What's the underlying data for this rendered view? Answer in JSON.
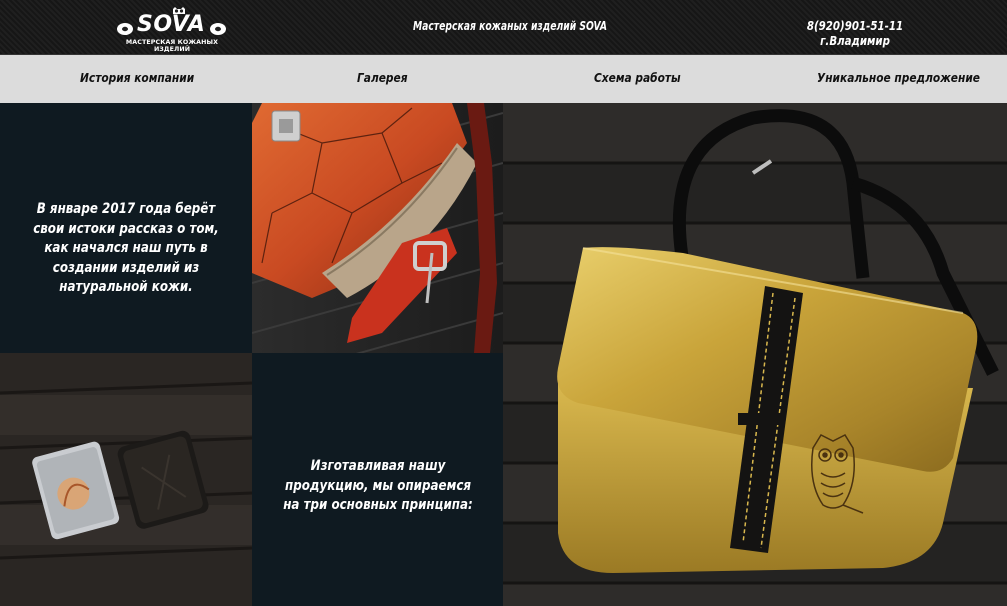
{
  "header": {
    "logo_word": "SOVA",
    "logo_subtitle": "МАСТЕРСКАЯ КОЖАНЫХ ИЗДЕЛИЙ",
    "title": "Мастерская кожаных изделий SOVA",
    "phone_city": "8(920)901-51-11 г.Владимир"
  },
  "nav": {
    "items": [
      {
        "label": "История компании"
      },
      {
        "label": "Галерея"
      },
      {
        "label": "Схема работы"
      },
      {
        "label": "Уникальное предложение"
      }
    ]
  },
  "tiles": {
    "intro_text": "В январе 2017 года берёт свои истоки рассказ о том, как начался наш путь в создании изделий из натуральной кожи.",
    "principles_text": "Изготавливая нашу продукцию, мы опираемся на три основных принципа:"
  },
  "colors": {
    "dark_panel": "#0f1a21",
    "nav_bg": "#dcdcdc",
    "leather_orange": "#d2542a",
    "gold": "#c9a43a"
  }
}
